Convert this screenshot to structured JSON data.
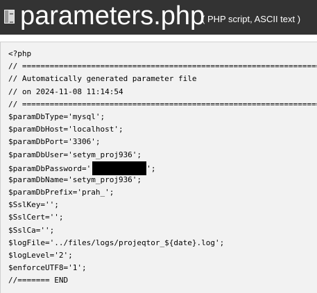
{
  "header": {
    "icon": "file-icon",
    "title": "parameters.php",
    "file_info": "( PHP script, ASCII text )"
  },
  "code": {
    "lines": [
      "<?php",
      "// ===================================================================",
      "// Automatically generated parameter file",
      "// on 2024-11-08 11:14:54",
      "// ===================================================================",
      "$paramDbType='mysql';",
      "$paramDbHost='localhost';",
      "$paramDbPort='3306';",
      "$paramDbUser='setym_proj936';",
      "$paramDbName='setym_proj936';",
      "$paramDbPrefix='prah_';",
      "$SslKey='';",
      "$SslCert='';",
      "$SslCa='';",
      "$logFile='../files/logs/projeqtor_${date}.log';",
      "$logLevel='2';",
      "$enforceUTF8='1';",
      "//======= END"
    ],
    "password_line": {
      "prefix": "$paramDbPassword='",
      "suffix": "';"
    }
  }
}
